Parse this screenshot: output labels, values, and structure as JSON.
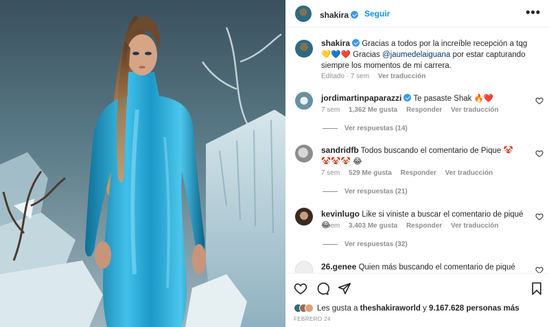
{
  "post": {
    "image_alt": "Shakira in a shiny blue latex dress with a long ponytail standing in an icy set",
    "author": "shakira",
    "follow_label": "Seguir",
    "more_label": "•••"
  },
  "caption": {
    "username": "shakira",
    "text_before": "Gracias a todos por la increíble recepción a tqg 💛💙❤️ Gracias ",
    "mention": "@jaumedelaiguana",
    "text_after": " por estar capturando siempre los momentos de mi carrera.",
    "edited": "Editado · 7 sem",
    "translate": "Ver traducción"
  },
  "comments": [
    {
      "username": "jordimartinpaparazzi",
      "verified": true,
      "text": "Te pasaste Shak 🔥❤️",
      "time": "7 sem",
      "likes": "1,362 Me gusta",
      "reply": "Responder",
      "translate": "Ver traducción",
      "replies": "Ver respuestas (14)"
    },
    {
      "username": "sandridfb",
      "verified": false,
      "text": "Todos buscando el comentario de Pique 🤡🤡🤡🤡 😂",
      "time": "7 sem",
      "likes": "529 Me gusta",
      "reply": "Responder",
      "translate": "Ver traducción",
      "replies": "Ver respuestas (21)"
    },
    {
      "username": "kevinlugo",
      "verified": false,
      "text": "Like si viniste a buscar el comentario de piqué 😂",
      "time": "7 sem",
      "likes": "3,403 Me gusta",
      "reply": "Responder",
      "translate": "Ver traducción",
      "replies": "Ver respuestas (32)"
    },
    {
      "username": "26.genee",
      "verified": false,
      "text": "Quien más buscando el comentario de piqué 🥴🤡",
      "time": "",
      "likes": "",
      "reply": "",
      "translate": "",
      "replies": ""
    }
  ],
  "footer": {
    "likes_prefix": "Les gusta a ",
    "likes_user": "theshakiraworld",
    "likes_middle": " y ",
    "likes_count": "9.167.628 personas más",
    "date": "FEBRERO 24"
  },
  "icons": {
    "like": "heart-icon",
    "comment": "comment-icon",
    "share": "share-icon",
    "save": "bookmark-icon"
  },
  "colors": {
    "accent": "#0095f6",
    "verified": "#3897f0",
    "dress": "#2aa7d6"
  }
}
